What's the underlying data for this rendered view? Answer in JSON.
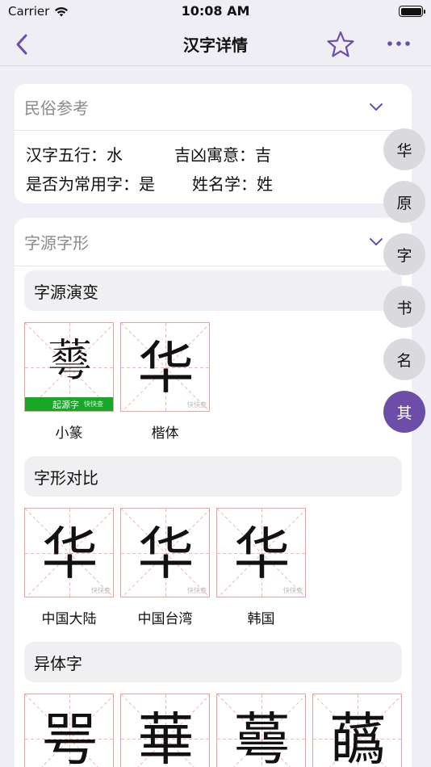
{
  "status": {
    "carrier": "Carrier",
    "time": "10:08 AM"
  },
  "nav": {
    "title": "汉字详情"
  },
  "folk": {
    "title": "民俗参考",
    "row1": {
      "a": "汉字五行：水",
      "b": "吉凶寓意：吉"
    },
    "row2": {
      "a": "是否为常用字：是",
      "b": "姓名学：姓"
    }
  },
  "origin": {
    "title": "字源字形",
    "evolution": {
      "title": "字源演变",
      "items": [
        {
          "char": "𦾓",
          "label": "小篆",
          "badge": "起源字",
          "watermark": "快快查"
        },
        {
          "char": "华",
          "label": "楷体",
          "watermark": "快快查"
        }
      ]
    },
    "compare": {
      "title": "字形对比",
      "items": [
        {
          "char": "华",
          "label": "中国大陆",
          "watermark": "快快查"
        },
        {
          "char": "华",
          "label": "中国台湾",
          "watermark": "快快查"
        },
        {
          "char": "华",
          "label": "韩国",
          "watermark": "快快查"
        }
      ]
    },
    "variants": {
      "title": "异体字",
      "items": [
        {
          "char": "咢"
        },
        {
          "char": "華"
        },
        {
          "char": "蕚"
        },
        {
          "char": "蘤"
        }
      ]
    }
  },
  "side_index": [
    "华",
    "原",
    "字",
    "书",
    "名",
    "其"
  ],
  "colors": {
    "accent": "#6c4ea8",
    "badge_green": "#17a82a",
    "grid_red": "#f0a0a0"
  }
}
